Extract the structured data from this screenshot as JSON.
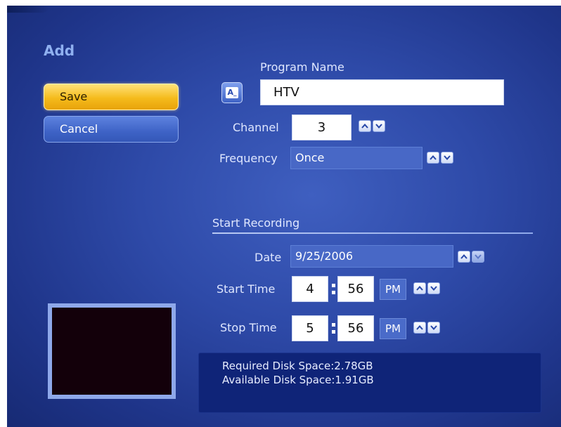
{
  "page": {
    "title": "Add"
  },
  "actions": {
    "save_label": "Save",
    "cancel_label": "Cancel"
  },
  "program": {
    "label": "Program Name",
    "value": "HTV",
    "keyboard_icon_text": "A"
  },
  "channel": {
    "label": "Channel",
    "value": "3"
  },
  "frequency": {
    "label": "Frequency",
    "value": "Once"
  },
  "start_recording": {
    "heading": "Start Recording",
    "date": {
      "label": "Date",
      "value": "9/25/2006"
    },
    "start_time": {
      "label": "Start Time",
      "hour": "4",
      "minute": "56",
      "ampm": "PM"
    },
    "stop_time": {
      "label": "Stop Time",
      "hour": "5",
      "minute": "56",
      "ampm": "PM"
    }
  },
  "disk": {
    "required": "Required Disk Space:2.78GB",
    "available": "Available Disk Space:1.91GB"
  },
  "colors": {
    "background": "#2e4aa8",
    "save_button": "#f5bb1c",
    "button": "#3e63c6",
    "info_panel": "#0f2478",
    "preview": "#13000a"
  }
}
